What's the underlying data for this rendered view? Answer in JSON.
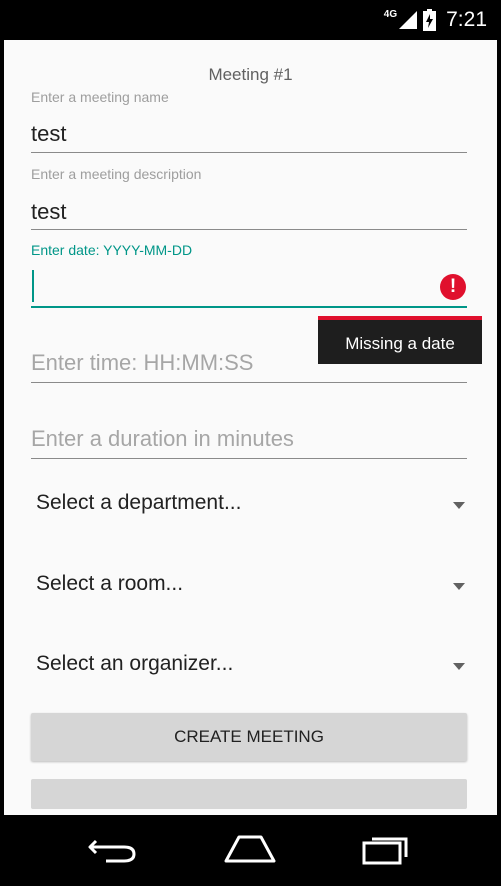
{
  "status_bar": {
    "network": "4G",
    "time": "7:21"
  },
  "form": {
    "title": "Meeting #1",
    "name_field": {
      "label": "Enter a meeting name",
      "value": "test"
    },
    "description_field": {
      "label": "Enter a meeting description",
      "value": "test"
    },
    "date_field": {
      "label": "Enter date: YYYY-MM-DD",
      "value": "",
      "error_icon": "!",
      "error_message": "Missing a date"
    },
    "time_field": {
      "placeholder": "Enter time: HH:MM:SS"
    },
    "duration_field": {
      "placeholder": "Enter a duration in minutes"
    },
    "department_select": {
      "selected": "Select a department..."
    },
    "room_select": {
      "selected": "Select a room..."
    },
    "organizer_select": {
      "selected": "Select an organizer..."
    },
    "create_button": "CREATE MEETING"
  },
  "icons": {
    "signal": "signal-icon",
    "battery": "battery-icon",
    "error": "error-icon",
    "dropdown": "dropdown-arrow-icon",
    "back": "back-icon",
    "home": "home-icon",
    "recents": "recents-icon"
  },
  "colors": {
    "accent": "#009688",
    "error": "#e0102d",
    "button_bg": "#d6d6d6",
    "background": "#fafafa"
  }
}
